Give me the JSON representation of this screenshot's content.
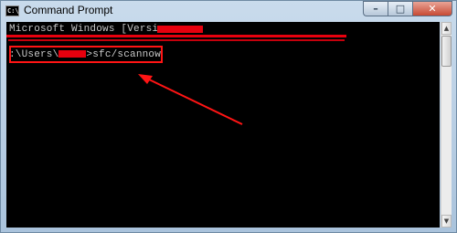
{
  "window": {
    "title": "Command Prompt",
    "icon": "cmd-icon",
    "buttons": {
      "minimize": "–",
      "maximize": "□",
      "close": "✕"
    }
  },
  "console": {
    "header_line": "Microsoft Windows [Version ",
    "prompt_prefix": ":\\Users\\",
    "command": ">sfc/scannow"
  },
  "annotation": {
    "color": "#ff1414"
  },
  "scrollbar": {
    "up": "▲",
    "down": "▼"
  }
}
